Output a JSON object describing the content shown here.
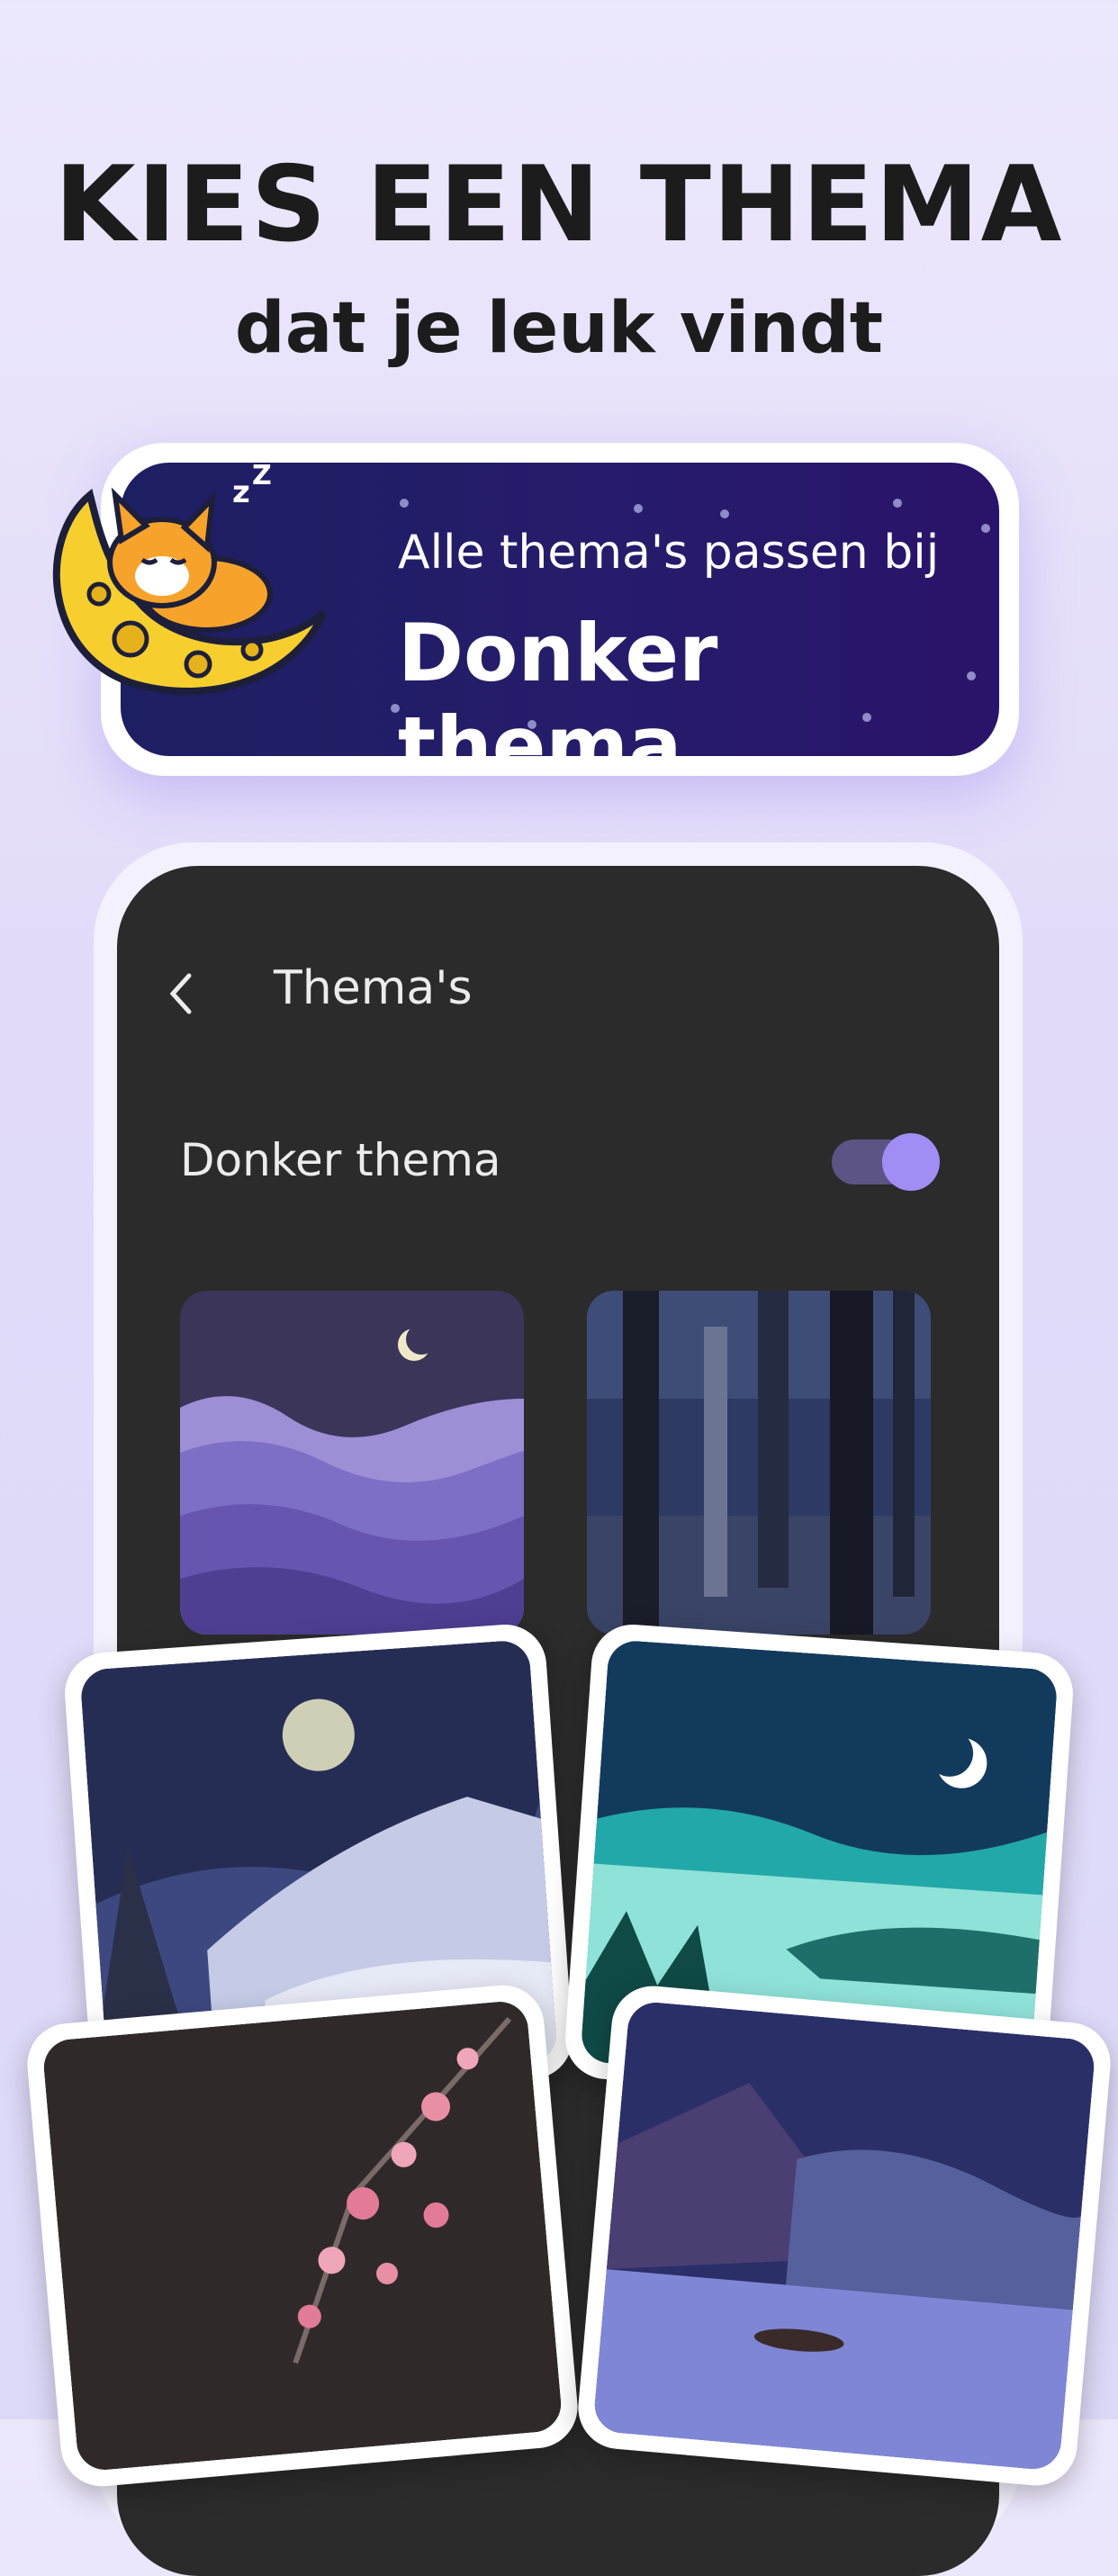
{
  "hero": {
    "title": "KIES EEN THEMA",
    "subtitle": "dat je leuk vindt"
  },
  "banner": {
    "line1": "Alle thema's passen bij",
    "line2": "Donker thema"
  },
  "screen": {
    "title": "Thema's",
    "dark_mode_label": "Donker thema",
    "dark_mode_on": true
  },
  "colors": {
    "accent": "#a08ef4",
    "screen_bg": "#2b2b2b",
    "banner_bg": "#231c68"
  },
  "themes": [
    {
      "name": "purple-mountains-theme"
    },
    {
      "name": "dark-forest-theme"
    },
    {
      "name": "snowy-moon-theme"
    },
    {
      "name": "teal-lake-theme"
    },
    {
      "name": "cherry-blossom-theme"
    },
    {
      "name": "night-lake-boat-theme"
    }
  ]
}
